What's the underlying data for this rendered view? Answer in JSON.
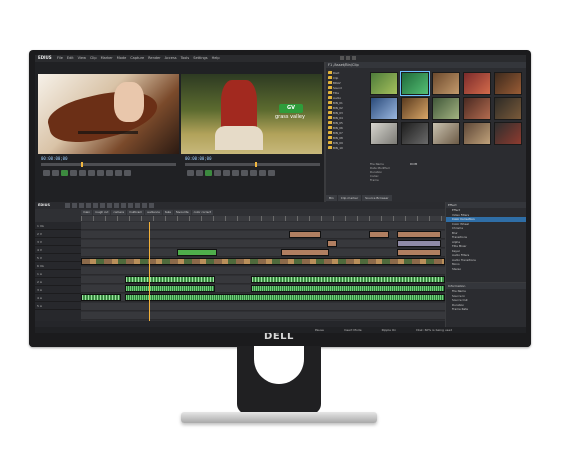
{
  "monitor": {
    "brand": "DELL"
  },
  "app": {
    "name": "EDIUS",
    "menu": [
      "File",
      "Edit",
      "View",
      "Clip",
      "Marker",
      "Mode",
      "Capture",
      "Render",
      "Access",
      "Tools",
      "Settings",
      "Help"
    ]
  },
  "player": {
    "timecode_left": "00:00:00;00",
    "timecode_right": "00:00:00;00",
    "overlay_logo": "GV",
    "overlay_text": "grass valley"
  },
  "browser": {
    "header": "F1 /Asset/Bin/Clip",
    "tree": [
      "Root",
      "Clip",
      "BDAV",
      "Sound",
      "Title",
      "Audio",
      "BIN_01",
      "BIN_02",
      "BIN_03",
      "BIN_04",
      "BIN_05",
      "BIN_06",
      "BIN_07",
      "BIN_08",
      "BIN_09",
      "BIN_10"
    ],
    "properties": [
      {
        "key": "File Name",
        "value": "DCIM"
      },
      {
        "key": "Date Modified",
        "value": ""
      },
      {
        "key": "Duration",
        "value": ""
      },
      {
        "key": "Codec",
        "value": ""
      },
      {
        "key": "Frame",
        "value": ""
      }
    ],
    "tabs": [
      "Bin",
      "Clip marker",
      "Source Browser"
    ]
  },
  "timeline": {
    "title": "EDIUS",
    "sequences": [
      "main",
      "rough cut",
      "camera",
      "multicam",
      "audience",
      "take",
      "favourite",
      "color correct"
    ],
    "tracks": [
      "1 VA",
      "2 V",
      "3 V",
      "4 V",
      "5 V",
      "6 VA",
      "1 A",
      "2 A",
      "3 A",
      "4 A",
      "5 A"
    ]
  },
  "effects_panel": {
    "title": "Effect",
    "items": [
      "Effect",
      "Video Filters",
      "Color Correction",
      "Color Wheel",
      "Chroma",
      "Blur",
      "Transitions",
      "Alpha",
      "Title Mixer",
      "Keyer",
      "Audio Filters",
      "Audio Transitions",
      "Mono",
      "Stereo"
    ],
    "selected": 2
  },
  "info_panel": {
    "title": "Information",
    "rows": [
      "File Name",
      "Source In",
      "Source Out",
      "Duration",
      "Frame Rate"
    ]
  },
  "statusbar": [
    "Pause",
    "Insert Mode",
    "Ripple On",
    "Disk: 60% is being used"
  ]
}
